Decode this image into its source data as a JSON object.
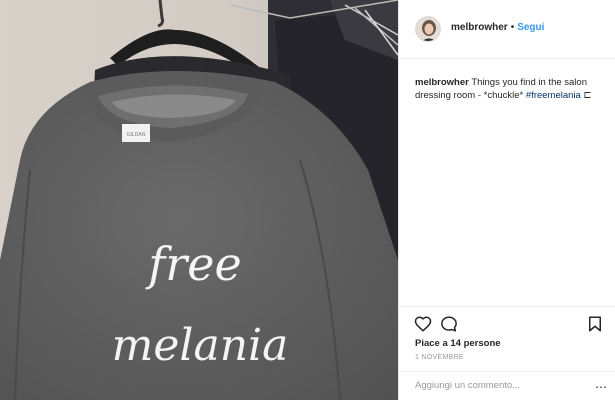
{
  "post": {
    "author": {
      "username": "melbrowher",
      "separator": "•",
      "follow_label": "Segui"
    },
    "caption": {
      "username": "melbrowher",
      "text": " Things you find in the salon dressing room - *chuckle* ",
      "hashtag": "#freemelania",
      "trailing": " ⊏"
    },
    "image": {
      "shirt_text_line1": "free",
      "shirt_text_line2": "melania",
      "tag_label": "GILDAN"
    },
    "actions": {
      "like_icon": "heart-outline-icon",
      "comment_icon": "speech-bubble-icon",
      "save_icon": "bookmark-icon"
    },
    "likes": "Piace a 14 persone",
    "date": "1 NOVEMBRE",
    "comment": {
      "placeholder": "Aggiungi un commento...",
      "more_icon": "more-dots-icon",
      "more_glyph": "⋯"
    }
  }
}
